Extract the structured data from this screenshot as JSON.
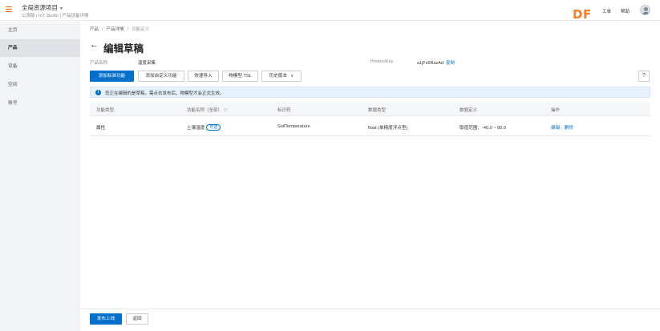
{
  "topbar": {
    "project_title": "全局资源项目",
    "project_caret": "▼",
    "project_sub": "公测版 | IoT Studio | 产品设备详情",
    "logo": "DF",
    "link_tools": "工单",
    "link_help": "帮助"
  },
  "sidebar": {
    "items": [
      {
        "label": "主页"
      },
      {
        "label": "产品"
      },
      {
        "label": "设备"
      },
      {
        "label": "空间"
      },
      {
        "label": "账号"
      }
    ]
  },
  "breadcrumb": {
    "items": [
      "产品",
      "产品详情",
      "功能定义"
    ],
    "sep": "/"
  },
  "page": {
    "back": "←",
    "title": "编辑草稿",
    "product_name_label": "产品名称",
    "product_name_value": "温度采集",
    "product_key_label": "ProductKey",
    "product_key_value": "a1jFs5RazAd",
    "copy_label": "复制"
  },
  "toolbar": {
    "add_standard": "添加标准功能",
    "add_custom": "添加自定义功能",
    "quick_import": "快速导入",
    "model_tsl": "物模型 TSL",
    "history": "历史版本",
    "history_chev": "∨",
    "help": "?"
  },
  "notice": {
    "icon": "i",
    "text": "您正在编辑的是草稿，需点击发布后，物模型才会正式生效。"
  },
  "table": {
    "headers": {
      "type": "功能类型",
      "name": "功能名称（全部）",
      "filter": "▽",
      "identifier": "标识符",
      "data_type": "数据类型",
      "definition": "数据定义",
      "ops": "操作"
    },
    "rows": [
      {
        "type": "属性",
        "name": "土壤温度",
        "tag": "可选",
        "identifier": "SoilTemperature",
        "data_type": "float (单精度浮点型)",
        "definition": "取值范围：-40.0 ~ 80.0",
        "edit": "编辑",
        "sep": "|",
        "delete": "删除"
      }
    ]
  },
  "footer": {
    "publish": "发布上线",
    "back": "返回"
  },
  "colors": {
    "accent": "#0070cc",
    "brand_orange": "#ff6a00"
  }
}
